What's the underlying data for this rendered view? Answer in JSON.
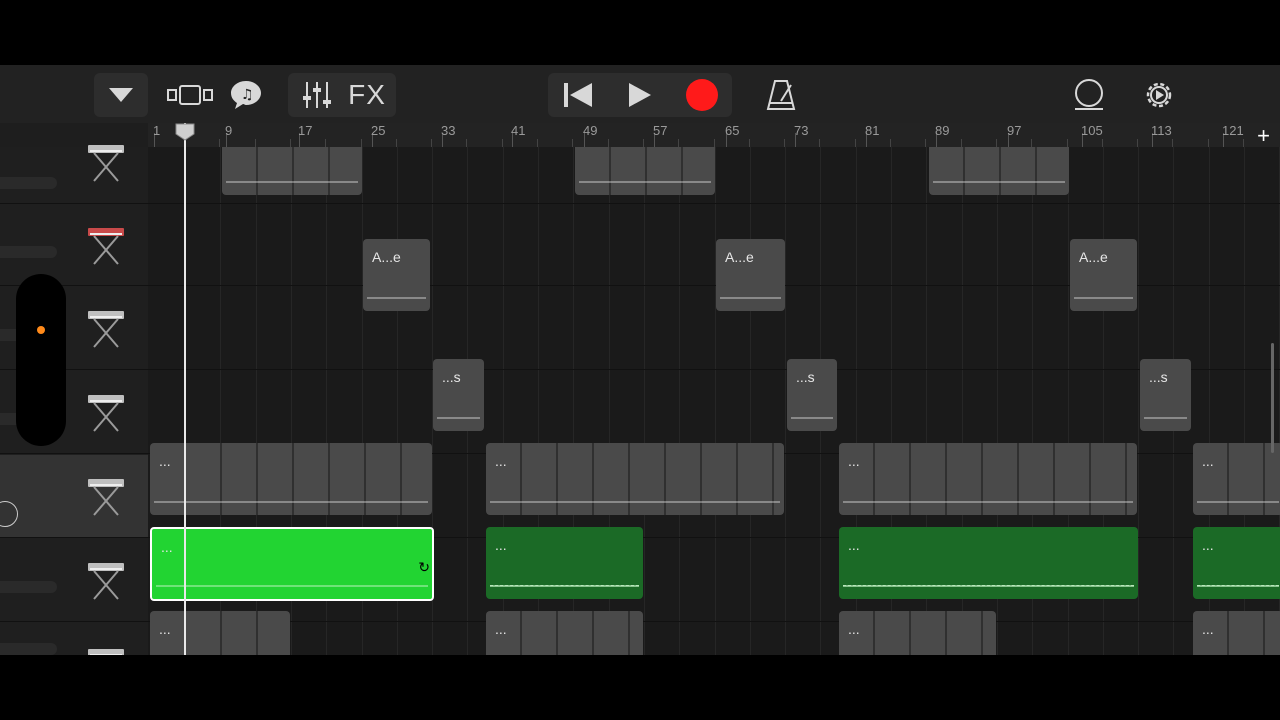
{
  "toolbar": {
    "fx_label": "FX",
    "icons": [
      "dropdown-triangle-icon",
      "tracks-view-icon",
      "speech-bubble-icon",
      "mixer-icon",
      "rewind-icon",
      "play-icon",
      "record-icon",
      "metronome-icon",
      "loop-browser-icon",
      "settings-icon"
    ],
    "record_color": "#ff1a1a"
  },
  "ruler": {
    "bar_labels": [
      "1",
      "9",
      "17",
      "25",
      "33",
      "41",
      "49",
      "57",
      "65",
      "73",
      "81",
      "89",
      "97",
      "105",
      "113",
      "121"
    ],
    "add_label": "+"
  },
  "regions": {
    "label_ae": "A...e",
    "label_s": "...s",
    "label_dots": "..."
  },
  "colors": {
    "accent_green": "#22d432",
    "dark_green": "#1b6a26",
    "region_gray": "#4a4a4a",
    "playhead": "#e9e9e9",
    "volume_dot": "#ff8a1a"
  }
}
